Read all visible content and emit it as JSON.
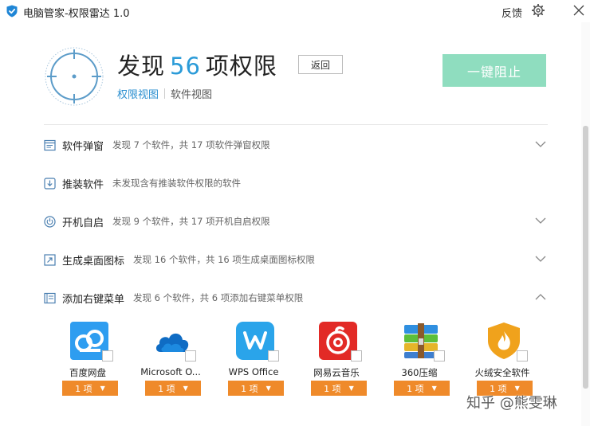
{
  "titlebar": {
    "title": "电脑管家-权限雷达 1.0",
    "feedback": "反馈",
    "settings_icon": "gear-icon",
    "close_icon": "close-icon"
  },
  "header": {
    "prefix": "发现",
    "count": "56",
    "suffix": "项权限",
    "back_label": "返回",
    "tabs": [
      "权限视图",
      "软件视图"
    ],
    "active_tab": "权限视图",
    "block_all_label": "一键阻止"
  },
  "colors": {
    "accent_blue": "#2b9bd8",
    "block_button": "#8fddbf",
    "dropdown_orange": "#ef8a2a"
  },
  "categories": [
    {
      "title": "软件弹窗",
      "desc": "发现 7 个软件，共 17 项软件弹窗权限",
      "icon": "popup-window-icon",
      "expanded": false
    },
    {
      "title": "推装软件",
      "desc": "未发现含有推装软件权限的软件",
      "icon": "download-icon",
      "expanded": false
    },
    {
      "title": "开机自启",
      "desc": "发现 9 个软件，共 17 项开机自启权限",
      "icon": "power-icon",
      "expanded": false
    },
    {
      "title": "生成桌面图标",
      "desc": "发现 16 个软件，共 16 项生成桌面图标权限",
      "icon": "desktop-shortcut-icon",
      "expanded": false
    },
    {
      "title": "添加右键菜单",
      "desc": "发现 6 个软件，共 6 项添加右键菜单权限",
      "icon": "context-menu-icon",
      "expanded": true
    }
  ],
  "apps": [
    {
      "name": "百度网盘",
      "perm": "1 项",
      "icon": "baidu-netdisk-icon"
    },
    {
      "name": "Microsoft O...",
      "perm": "1 项",
      "icon": "onedrive-cloud-icon"
    },
    {
      "name": "WPS Office",
      "perm": "1 项",
      "icon": "wps-office-icon"
    },
    {
      "name": "网易云音乐",
      "perm": "1 项",
      "icon": "netease-music-icon"
    },
    {
      "name": "360压缩",
      "perm": "1 项",
      "icon": "archive-zip-icon"
    },
    {
      "name": "火绒安全软件",
      "perm": "1 项",
      "icon": "huorong-shield-icon"
    }
  ],
  "watermark": "知乎 @熊雯琳"
}
